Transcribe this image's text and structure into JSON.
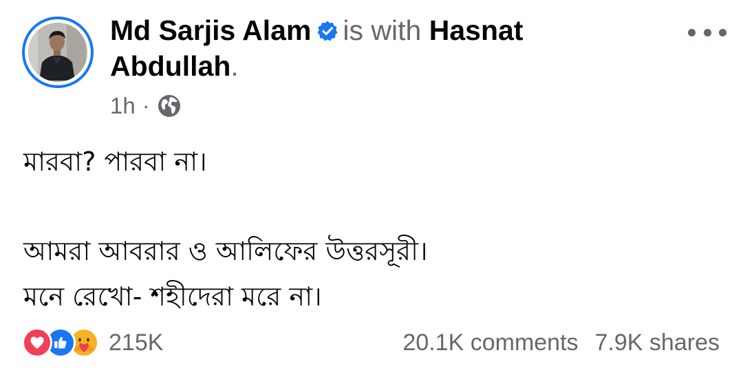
{
  "post": {
    "author": "Md Sarjis Alam",
    "with_text": "is with",
    "with_name": "Hasnat Abdullah",
    "period": ".",
    "time": "1h",
    "dot": "·",
    "audience_icon": "globe-icon",
    "verified_icon": "verified-badge-icon",
    "more_icon": "more-options-icon",
    "body_lines": [
      "মারবা? পারবা না।",
      "",
      "আমরা আবরার ও আলিফের উত্তরসূরী।",
      "মনে রেখো- শহীদেরা মরে না।"
    ]
  },
  "engagement": {
    "reaction_icons": [
      "love-reaction-icon",
      "like-reaction-icon",
      "care-reaction-icon"
    ],
    "reactions_count": "215K",
    "comments": "20.1K comments",
    "shares": "7.9K shares"
  },
  "colors": {
    "facebook_blue": "#1877f2",
    "secondary_text": "#65676b",
    "love_red": "#f33e58",
    "care_yellow": "#f7b125"
  }
}
